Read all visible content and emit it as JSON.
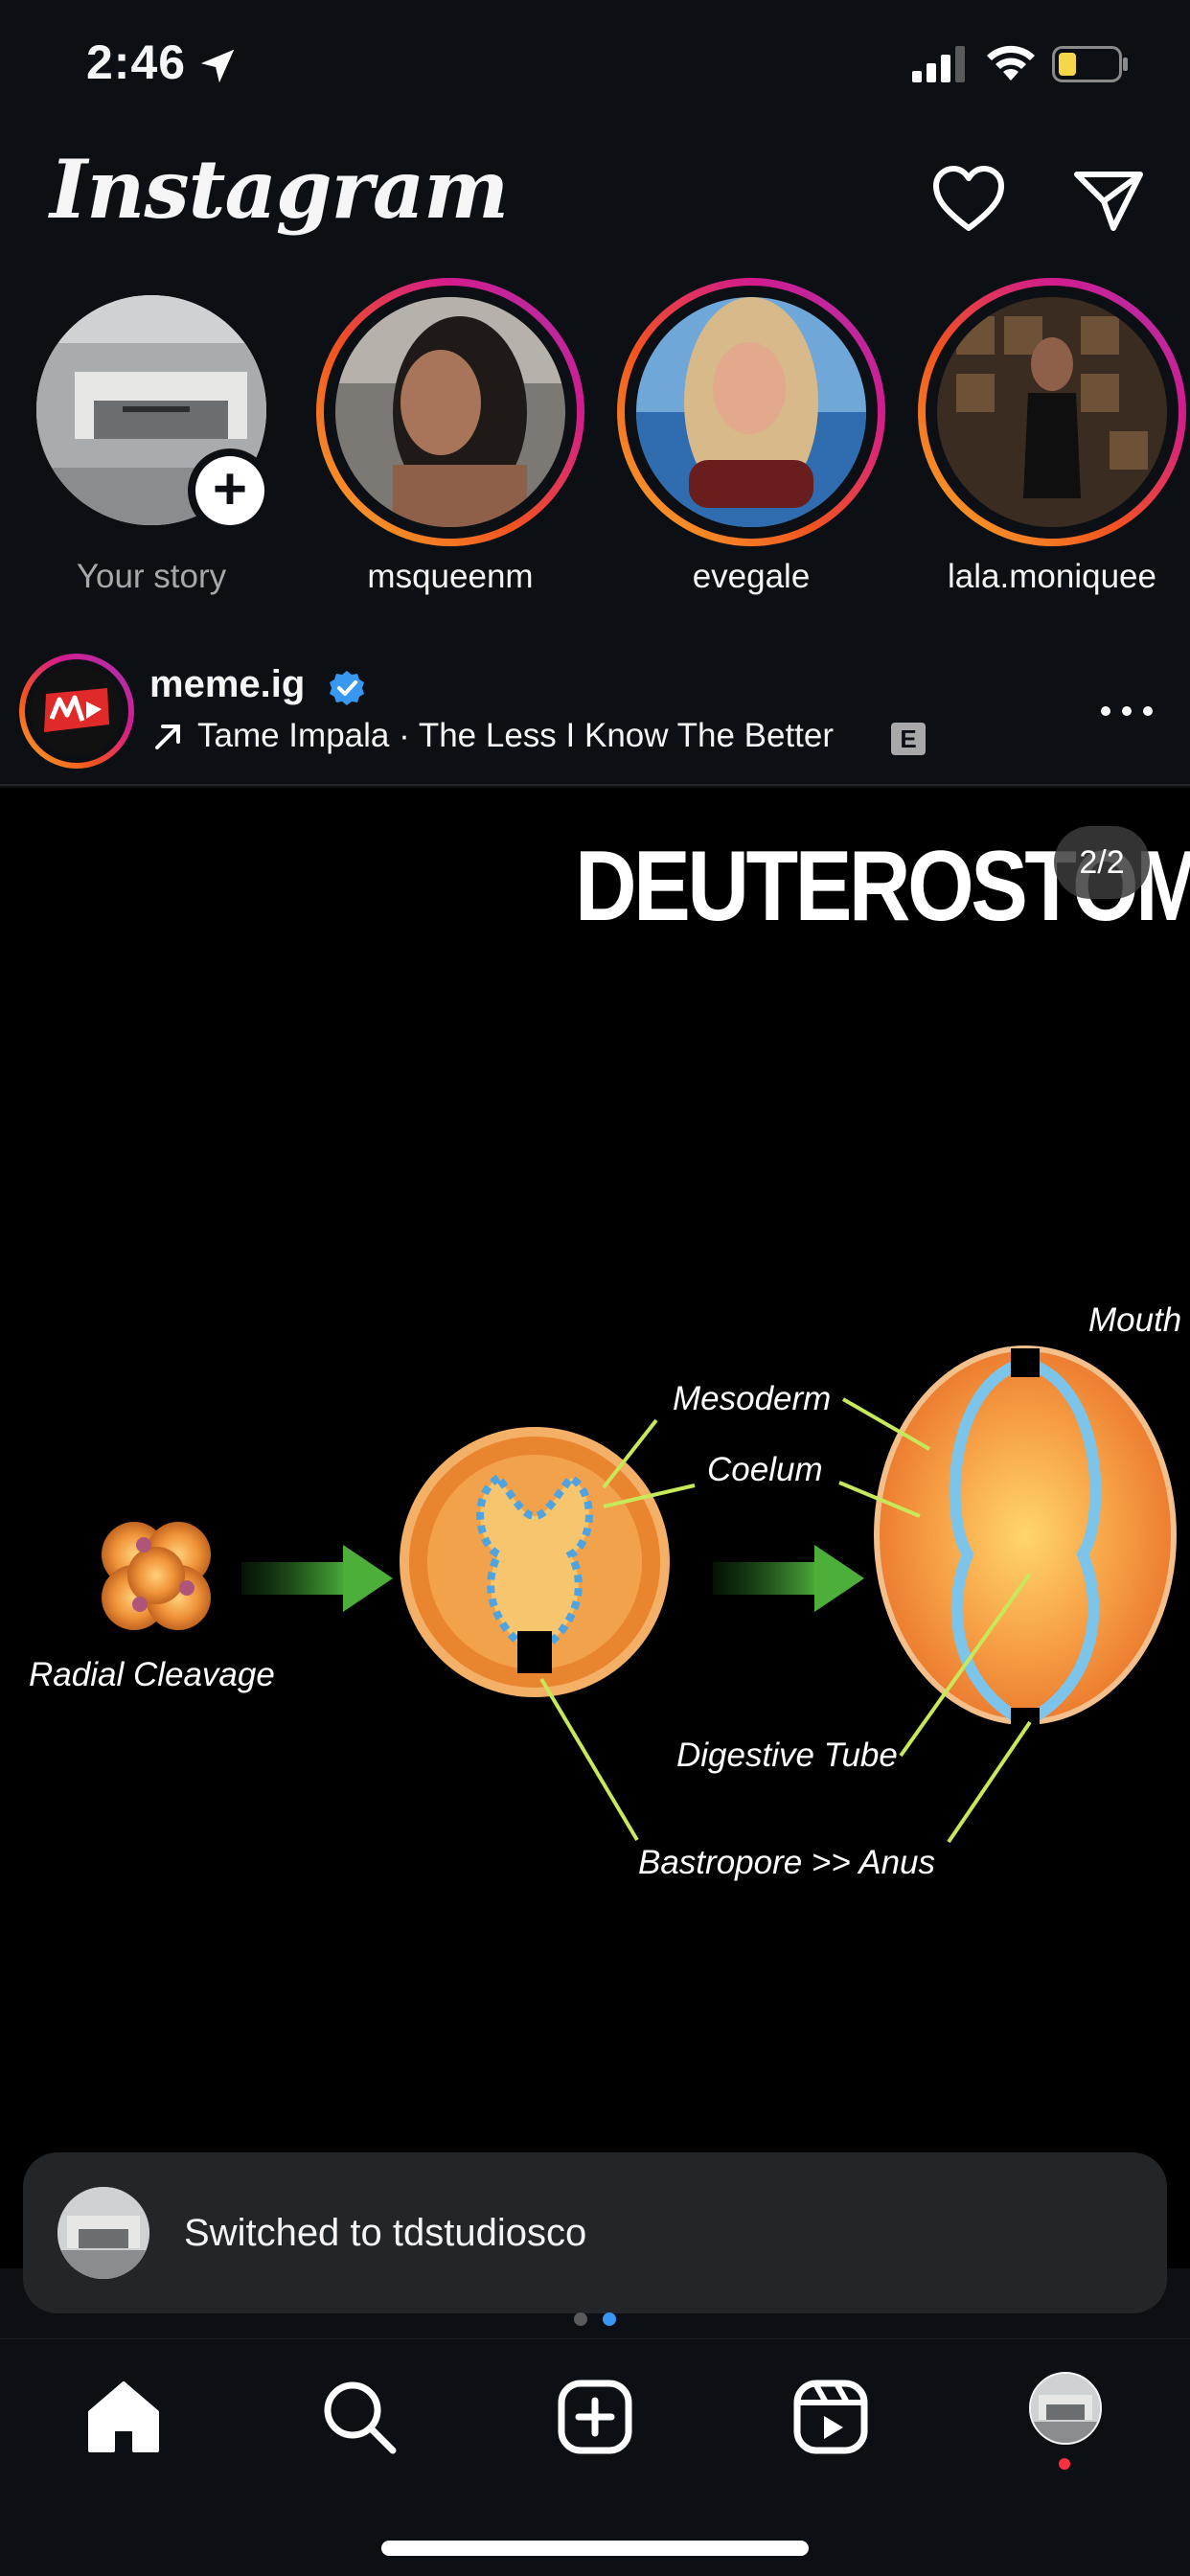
{
  "status_bar": {
    "time": "2:46",
    "battery_color": "#f7d74a"
  },
  "header": {
    "logo": "Instagram",
    "icons": [
      "heart-icon",
      "paper-plane-icon"
    ]
  },
  "stories": [
    {
      "label": "Your story",
      "own": true
    },
    {
      "label": "msqueenm"
    },
    {
      "label": "evegale"
    },
    {
      "label": "lala.moniquee"
    }
  ],
  "post": {
    "username": "meme.ig",
    "verified": true,
    "music": "Tame Impala · The Less I Know The Better",
    "explicit_badge": "E",
    "image": {
      "title": "DEUTEROSTOMES",
      "counter": "2/2",
      "labels": {
        "mouth": "Mouth",
        "mesoderm": "Mesoderm",
        "coelum": "Coelum",
        "radial_cleavage": "Radial Cleavage",
        "digestive_tube": "Digestive Tube",
        "bastropore": "Bastropore >> Anus"
      }
    },
    "carousel": {
      "pages": 2,
      "current": 2
    }
  },
  "toast": {
    "text": "Switched to tdstudiosco"
  },
  "bottom_nav": {
    "items": [
      "home-icon",
      "search-icon",
      "create-icon",
      "reels-icon",
      "profile-avatar"
    ],
    "notification_color": "#ff3040"
  },
  "colors": {
    "background": "#0c1014",
    "accent_blue": "#3897f0"
  }
}
